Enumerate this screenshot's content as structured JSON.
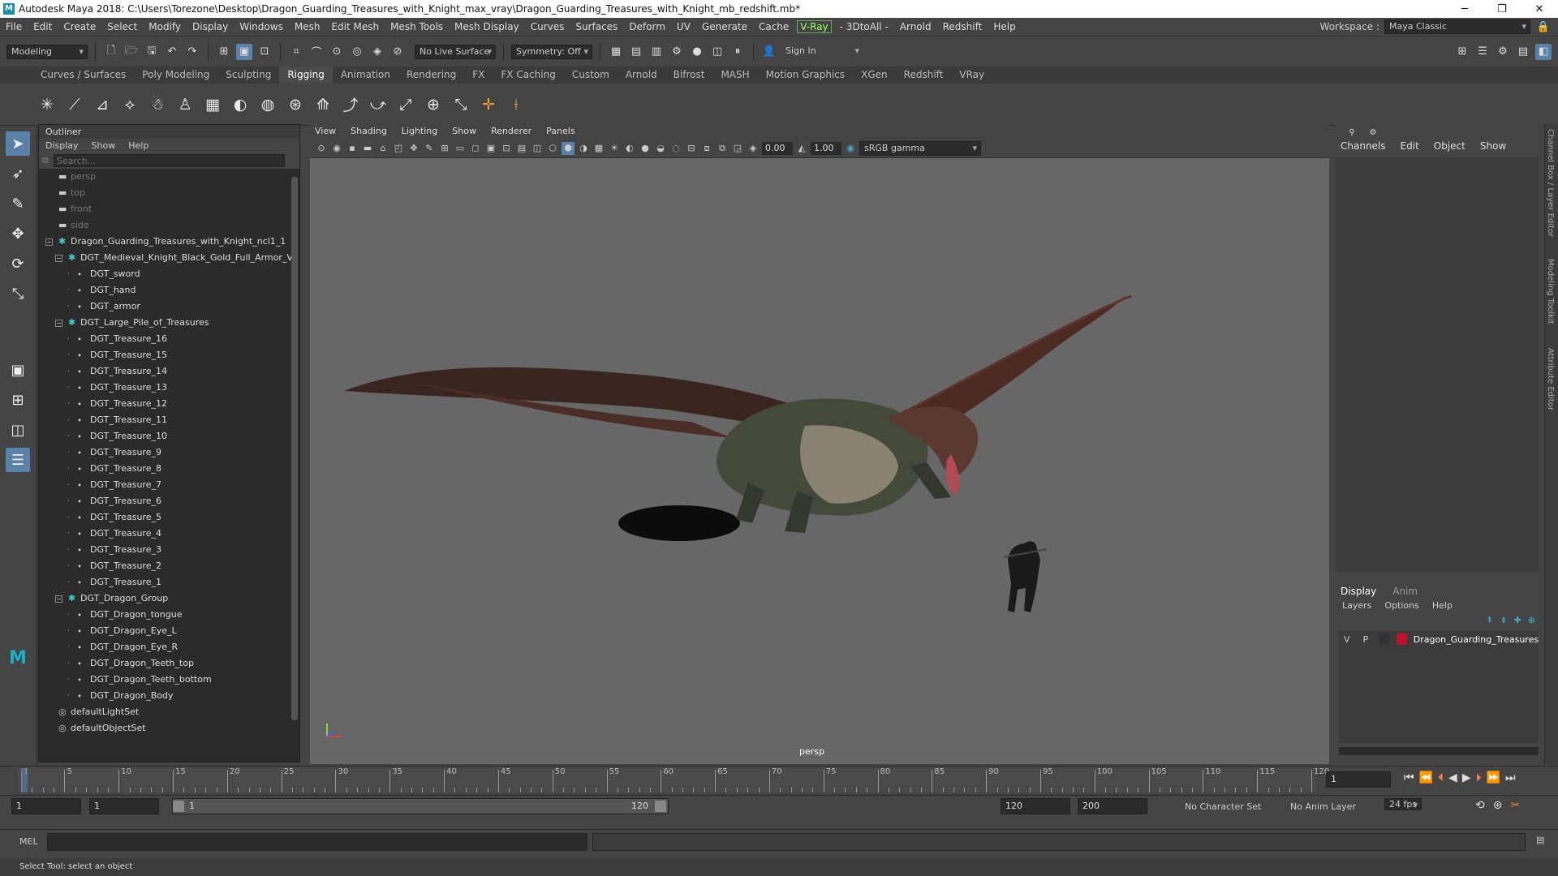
{
  "window": {
    "title": "Autodesk Maya 2018: C:\\Users\\Torezone\\Desktop\\Dragon_Guarding_Treasures_with_Knight_max_vray\\Dragon_Guarding_Treasures_with_Knight_mb_redshift.mb*",
    "logo": "M",
    "min": "─",
    "max": "❐",
    "close": "✕"
  },
  "menubar": {
    "items": [
      "File",
      "Edit",
      "Create",
      "Select",
      "Modify",
      "Display",
      "Windows",
      "Mesh",
      "Edit Mesh",
      "Mesh Tools",
      "Mesh Display",
      "Curves",
      "Surfaces",
      "Deform",
      "UV",
      "Generate",
      "Cache",
      "V-Ray",
      "- 3DtoAll -",
      "Arnold",
      "Redshift",
      "Help"
    ],
    "workspace_label": "Workspace :",
    "workspace_value": "Maya Classic"
  },
  "statusline": {
    "mode": "Modeling",
    "live_surface": "No Live Surface",
    "symmetry": "Symmetry: Off",
    "sign_in": "Sign In"
  },
  "shelf": {
    "tabs": [
      "Curves / Surfaces",
      "Poly Modeling",
      "Sculpting",
      "Rigging",
      "Animation",
      "Rendering",
      "FX",
      "FX Caching",
      "Custom",
      "Arnold",
      "Bifrost",
      "MASH",
      "Motion Graphics",
      "XGen",
      "Redshift",
      "VRay"
    ],
    "active_tab": "Rigging"
  },
  "outliner": {
    "title": "Outliner",
    "menu": [
      "Display",
      "Show",
      "Help"
    ],
    "search_placeholder": "Search...",
    "rows": [
      {
        "label": "persp",
        "level": 0,
        "kind": "camera",
        "dim": true
      },
      {
        "label": "top",
        "level": 0,
        "kind": "camera",
        "dim": true
      },
      {
        "label": "front",
        "level": 0,
        "kind": "camera",
        "dim": true
      },
      {
        "label": "side",
        "level": 0,
        "kind": "camera",
        "dim": true
      },
      {
        "label": "Dragon_Guarding_Treasures_with_Knight_ncl1_1",
        "level": 0,
        "kind": "group",
        "toggle": "−"
      },
      {
        "label": "DGT_Medieval_Knight_Black_Gold_Full_Armor_V",
        "level": 1,
        "kind": "group",
        "toggle": "−"
      },
      {
        "label": "DGT_sword",
        "level": 2,
        "kind": "mesh"
      },
      {
        "label": "DGT_hand",
        "level": 2,
        "kind": "mesh"
      },
      {
        "label": "DGT_armor",
        "level": 2,
        "kind": "mesh"
      },
      {
        "label": "DGT_Large_Pile_of_Treasures",
        "level": 1,
        "kind": "group",
        "toggle": "−"
      },
      {
        "label": "DGT_Treasure_16",
        "level": 2,
        "kind": "mesh"
      },
      {
        "label": "DGT_Treasure_15",
        "level": 2,
        "kind": "mesh"
      },
      {
        "label": "DGT_Treasure_14",
        "level": 2,
        "kind": "mesh"
      },
      {
        "label": "DGT_Treasure_13",
        "level": 2,
        "kind": "mesh"
      },
      {
        "label": "DGT_Treasure_12",
        "level": 2,
        "kind": "mesh"
      },
      {
        "label": "DGT_Treasure_11",
        "level": 2,
        "kind": "mesh"
      },
      {
        "label": "DGT_Treasure_10",
        "level": 2,
        "kind": "mesh"
      },
      {
        "label": "DGT_Treasure_9",
        "level": 2,
        "kind": "mesh"
      },
      {
        "label": "DGT_Treasure_8",
        "level": 2,
        "kind": "mesh"
      },
      {
        "label": "DGT_Treasure_7",
        "level": 2,
        "kind": "mesh"
      },
      {
        "label": "DGT_Treasure_6",
        "level": 2,
        "kind": "mesh"
      },
      {
        "label": "DGT_Treasure_5",
        "level": 2,
        "kind": "mesh"
      },
      {
        "label": "DGT_Treasure_4",
        "level": 2,
        "kind": "mesh"
      },
      {
        "label": "DGT_Treasure_3",
        "level": 2,
        "kind": "mesh"
      },
      {
        "label": "DGT_Treasure_2",
        "level": 2,
        "kind": "mesh"
      },
      {
        "label": "DGT_Treasure_1",
        "level": 2,
        "kind": "mesh"
      },
      {
        "label": "DGT_Dragon_Group",
        "level": 1,
        "kind": "group",
        "toggle": "−"
      },
      {
        "label": "DGT_Dragon_tongue",
        "level": 2,
        "kind": "mesh"
      },
      {
        "label": "DGT_Dragon_Eye_L",
        "level": 2,
        "kind": "mesh"
      },
      {
        "label": "DGT_Dragon_Eye_R",
        "level": 2,
        "kind": "mesh"
      },
      {
        "label": "DGT_Dragon_Teeth_top",
        "level": 2,
        "kind": "mesh"
      },
      {
        "label": "DGT_Dragon_Teeth_bottom",
        "level": 2,
        "kind": "mesh"
      },
      {
        "label": "DGT_Dragon_Body",
        "level": 2,
        "kind": "mesh"
      },
      {
        "label": "defaultLightSet",
        "level": 0,
        "kind": "set"
      },
      {
        "label": "defaultObjectSet",
        "level": 0,
        "kind": "set"
      }
    ]
  },
  "viewport": {
    "menu": [
      "View",
      "Shading",
      "Lighting",
      "Show",
      "Renderer",
      "Panels"
    ],
    "exposure": "0.00",
    "gamma": "1.00",
    "color_space": "sRGB gamma",
    "camera_label": "persp"
  },
  "channelbox": {
    "menu": [
      "Channels",
      "Edit",
      "Object",
      "Show"
    ],
    "side_tabs": [
      "Channel Box / Layer Editor",
      "Modeling Toolkit",
      "Attribute Editor"
    ]
  },
  "layers": {
    "tabs": [
      "Display",
      "Anim"
    ],
    "active_tab": "Display",
    "menu": [
      "Layers",
      "Options",
      "Help"
    ],
    "layer": {
      "v": "V",
      "p": "P",
      "name": "Dragon_Guarding_Treasures_w",
      "color": "#c0102a"
    }
  },
  "timeline": {
    "ticks": [
      1,
      5,
      10,
      15,
      20,
      25,
      30,
      35,
      40,
      45,
      50,
      55,
      60,
      65,
      70,
      75,
      80,
      85,
      90,
      95,
      100,
      105,
      110,
      115,
      120
    ],
    "start": 1,
    "end": 120,
    "current_frame": "1"
  },
  "range": {
    "start": "1",
    "playback_start": "1",
    "slider_start": "1",
    "slider_end": "120",
    "playback_end": "120",
    "end": "200",
    "character_set": "No Character Set",
    "anim_layer": "No Anim Layer",
    "fps": "24 fps"
  },
  "cmd": {
    "label": "MEL"
  },
  "help": {
    "text": "Select Tool: select an object"
  },
  "colors": {
    "accent": "#5a82a8",
    "viewport_bg": "#676767"
  }
}
